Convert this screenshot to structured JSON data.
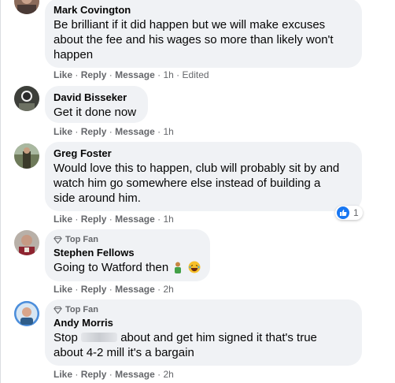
{
  "comments": [
    {
      "author": "Mark Covington",
      "lines": [
        "Be brilliant if it did happen but we will make excuses",
        "about the fee and his wages so more than likely won't",
        "happen"
      ],
      "like": "Like",
      "reply": "Reply",
      "message": "Message",
      "time": "1h",
      "edited": "Edited"
    },
    {
      "author": "David Bisseker",
      "lines": [
        "Get it done now"
      ],
      "like": "Like",
      "reply": "Reply",
      "message": "Message",
      "time": "1h"
    },
    {
      "author": "Greg Foster",
      "lines": [
        "Would love this to happen, club will probably sit by and",
        "watch him go somewhere else instead of building a",
        "side around him."
      ],
      "like": "Like",
      "reply": "Reply",
      "message": "Message",
      "time": "1h",
      "reaction_count": "1"
    },
    {
      "badge": "Top Fan",
      "author": "Stephen Fellows",
      "text": "Going to Watford then",
      "like": "Like",
      "reply": "Reply",
      "message": "Message",
      "time": "2h"
    },
    {
      "badge": "Top Fan",
      "author": "Andy Morris",
      "line1_start": "Stop",
      "line1_end": "about and get him signed it that's true",
      "line2": "about 4-2 mill it's a bargain",
      "like": "Like",
      "reply": "Reply",
      "message": "Message",
      "time": "2h"
    }
  ],
  "separator": "·",
  "colors": {
    "bubble": "#f0f2f5",
    "meta": "#65676b",
    "like_blue": "#1877f2"
  }
}
